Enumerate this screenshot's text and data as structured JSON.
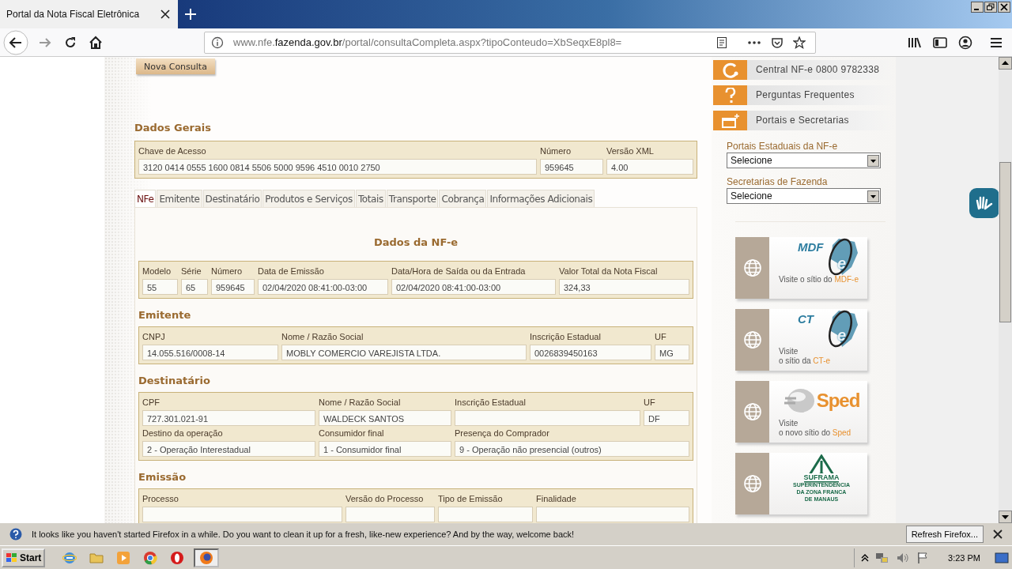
{
  "browser": {
    "tab_title": "Portal da Nota Fiscal Eletrônica",
    "url": "www.nfe.**fazenda.gov.br**/portal/consultaCompleta.aspx?tipoConteudo=XbSeqxE8pl8="
  },
  "page": {
    "new_query_button": "Nova Consulta",
    "general": {
      "heading": "Dados Gerais",
      "fields": [
        {
          "label": "Chave de Acesso",
          "value": "3120 0414 0555 1600 0814 5506 5000 9596 4510 0010 2750"
        },
        {
          "label": "Número",
          "value": "959645"
        },
        {
          "label": "Versão XML",
          "value": "4.00"
        }
      ]
    },
    "tabs": [
      {
        "label": "NFe",
        "selected": true
      },
      {
        "label": "Emitente",
        "selected": false
      },
      {
        "label": "Destinatário",
        "selected": false
      },
      {
        "label": "Produtos e Serviços",
        "selected": false
      },
      {
        "label": "Totais",
        "selected": false
      },
      {
        "label": "Transporte",
        "selected": false
      },
      {
        "label": "Cobrança",
        "selected": false
      },
      {
        "label": "Informações Adicionais",
        "selected": false
      }
    ],
    "panel_title": "Dados da NF-e",
    "groups": [
      {
        "rows": [
          [
            {
              "label": "Modelo",
              "value": "55"
            },
            {
              "label": "Série",
              "value": "65"
            },
            {
              "label": "Número",
              "value": "959645"
            },
            {
              "label": "Data de Emissão",
              "value": "02/04/2020 08:41:00-03:00"
            },
            {
              "label": "Data/Hora de Saída ou da Entrada",
              "value": "02/04/2020 08:41:00-03:00"
            },
            {
              "label": "Valor Total da Nota Fiscal",
              "value": "324,33"
            }
          ]
        ]
      },
      {
        "heading": "Emitente",
        "rows": [
          [
            {
              "label": "CNPJ",
              "value": "14.055.516/0008-14"
            },
            {
              "label": "Nome / Razão Social",
              "value": "MOBLY COMERCIO VAREJISTA LTDA."
            },
            {
              "label": "Inscrição Estadual",
              "value": "0026839450163"
            },
            {
              "label": "UF",
              "value": "MG"
            }
          ]
        ]
      },
      {
        "heading": "Destinatário",
        "rows": [
          [
            {
              "label": "CPF",
              "value": "727.301.021-91"
            },
            {
              "label": "Nome / Razão Social",
              "value": "WALDECK SANTOS"
            },
            {
              "label": "Inscrição Estadual"
            },
            {
              "label": "UF",
              "value": "DF"
            }
          ],
          [
            {
              "label": "Destino da operação",
              "value": "2 - Operação Interestadual"
            },
            {
              "label": "Consumidor final",
              "value": "1 - Consumidor final"
            },
            {
              "label": "Presença do Comprador",
              "value": "9 - Operação não presencial (outros)"
            }
          ]
        ]
      },
      {
        "heading": "Emissão",
        "rows": [
          [
            {
              "label": "Processo"
            },
            {
              "label": "Versão do Processo"
            },
            {
              "label": "Tipo de Emissão"
            },
            {
              "label": "Finalidade"
            }
          ]
        ]
      }
    ]
  },
  "sidebar": {
    "links": [
      {
        "kind": "phone",
        "label": "Central NF-e 0800 9782338"
      },
      {
        "kind": "help",
        "label": "Perguntas Frequentes"
      },
      {
        "kind": "portals",
        "label": "Portais e Secretarias"
      }
    ],
    "selects": [
      {
        "label": "Portais Estaduais da NF-e",
        "value": "Selecione"
      },
      {
        "label": "Secretarias de Fazenda",
        "value": "Selecione"
      }
    ],
    "banners": [
      {
        "kind": "mdfe",
        "logo_text": [
          "MDF",
          "e"
        ],
        "caption": [
          [
            {
              "text": "Visite o sítio do "
            },
            {
              "text": "MDF-e",
              "highlight": true
            }
          ]
        ]
      },
      {
        "kind": "cte",
        "logo_text": [
          "CT",
          "e"
        ],
        "caption": [
          [
            {
              "text": "Visite"
            }
          ],
          [
            {
              "text": "o sítio da "
            },
            {
              "text": "CT-e",
              "highlight": true
            }
          ]
        ]
      },
      {
        "kind": "sped",
        "logo_text": [
          "Sped"
        ],
        "caption": [
          [
            {
              "text": "Visite"
            }
          ],
          [
            {
              "text": "o novo sítio do "
            },
            {
              "text": "Sped",
              "highlight": true
            }
          ]
        ]
      },
      {
        "kind": "suframa",
        "logo_text": [
          "SUFRAMA"
        ],
        "caption": [
          [
            {
              "text": "SUPERINTENDÊNCIA"
            }
          ],
          [
            {
              "text": "DA ZONA FRANCA"
            }
          ],
          [
            {
              "text": "DE MANAUS"
            }
          ]
        ]
      }
    ]
  },
  "notification": {
    "message": "It looks like you haven't started Firefox in a while. Do you want to clean it up for a fresh, like-new experience? And by the way, welcome back!",
    "button": "Refresh Firefox..."
  },
  "taskbar": {
    "start": "Start",
    "apps": [
      {
        "kind": "ie",
        "selected": false
      },
      {
        "kind": "folder",
        "selected": false
      },
      {
        "kind": "media",
        "selected": false
      },
      {
        "kind": "chrome",
        "selected": false
      },
      {
        "kind": "opera",
        "selected": false
      },
      {
        "kind": "firefox",
        "selected": true
      }
    ],
    "clock": "3:23 PM"
  }
}
